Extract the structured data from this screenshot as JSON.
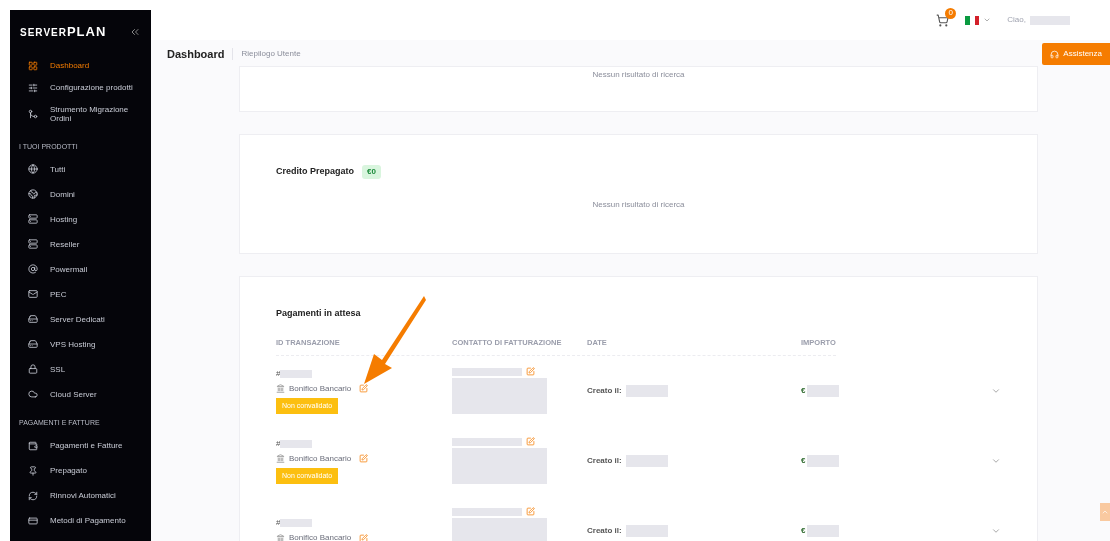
{
  "sidebar": {
    "logo": {
      "left": "SERVER",
      "right": "PLAN"
    },
    "items": [
      {
        "label": "Dashboard",
        "selected": true
      },
      {
        "label": "Configurazione prodotti",
        "selected": false
      },
      {
        "label": "Strumento Migrazione Ordini",
        "selected": false
      }
    ],
    "sections": [
      {
        "title": "I TUOI PRODOTTI",
        "items": [
          {
            "label": "Tutti",
            "selected": false
          },
          {
            "label": "Domini",
            "selected": false
          },
          {
            "label": "Hosting",
            "selected": false
          },
          {
            "label": "Reseller",
            "selected": false
          },
          {
            "label": "Powermail",
            "selected": false
          },
          {
            "label": "PEC",
            "selected": false
          },
          {
            "label": "Server Dedicati",
            "selected": false
          },
          {
            "label": "VPS Hosting",
            "selected": false
          },
          {
            "label": "SSL",
            "selected": false
          },
          {
            "label": "Cloud Server",
            "selected": false
          }
        ]
      },
      {
        "title": "PAGAMENTI E FATTURE",
        "items": [
          {
            "label": "Pagamenti e Fatture",
            "selected": false
          },
          {
            "label": "Prepagato",
            "selected": false
          },
          {
            "label": "Rinnovi Automatici",
            "selected": false
          },
          {
            "label": "Metodi di Pagamento",
            "selected": false
          }
        ]
      }
    ]
  },
  "topbar": {
    "cart_count": "0",
    "greeting": "Ciao,"
  },
  "header": {
    "title": "Dashboard",
    "subtitle": "Riepilogo Utente",
    "help_button": "Assistenza"
  },
  "cards": [
    {
      "empty_text": "Nessun risultato di ricerca"
    },
    {
      "title": "Credito Prepagato",
      "badge": "€0",
      "empty_text": "Nessun risultato di ricerca"
    }
  ],
  "pending": {
    "title": "Pagamenti in attesa",
    "columns": [
      "ID TRANSAZIONE",
      "CONTATTO DI FATTURAZIONE",
      "DATE",
      "IMPORTO"
    ],
    "rows": [
      {
        "id": "#",
        "method": "Bonifico Bancario",
        "status": "Non convalidato",
        "date_label": "Creato il:",
        "currency": "€"
      },
      {
        "id": "#",
        "method": "Bonifico Bancario",
        "status": "Non convalidato",
        "date_label": "Creato il:",
        "currency": "€"
      },
      {
        "id": "#",
        "method": "Bonifico Bancario",
        "date_label": "Creato il:",
        "currency": "€"
      }
    ]
  }
}
